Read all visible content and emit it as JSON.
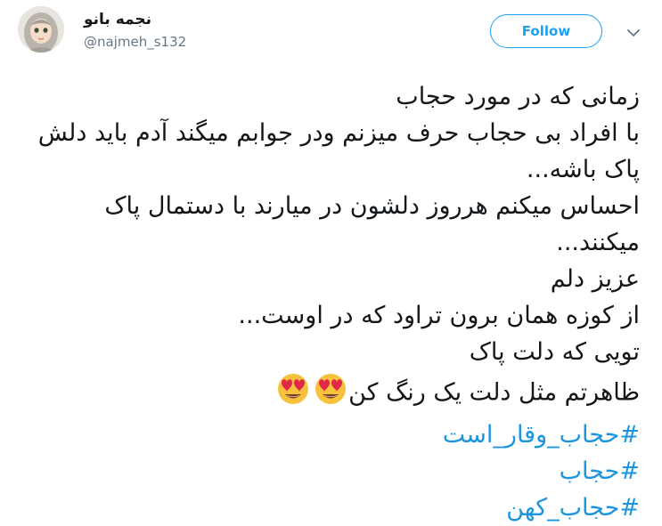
{
  "user": {
    "display_name": "نجمه بانو",
    "handle": "@najmeh_s132",
    "avatar_icon": "hijab-avatar-icon"
  },
  "actions": {
    "follow_label": "Follow",
    "menu_icon": "chevron-down-icon"
  },
  "tweet": {
    "lines": [
      "زمانی که در مورد حجاب",
      "با افراد بی حجاب حرف میزنم ودر جوابم میگند آدم باید دلش",
      "پاک باشه...",
      "احساس میکنم هرروز دلشون در میارند با دستمال پاک",
      "میکنند...",
      "عزیز دلم",
      "از کوزه همان برون تراود که در اوست...",
      "تویی که دلت پاک",
      "ظاهرتم مثل دلت یک رنگ کن"
    ],
    "emoji": "heart-eyes-emoji",
    "hashtags": [
      "#حجاب_وقار_است",
      "#حجاب",
      "#حجاب_کهن"
    ]
  },
  "colors": {
    "accent": "#1da1f2",
    "hashtag": "#1b95e0",
    "text": "#14171a",
    "muted": "#657786"
  }
}
